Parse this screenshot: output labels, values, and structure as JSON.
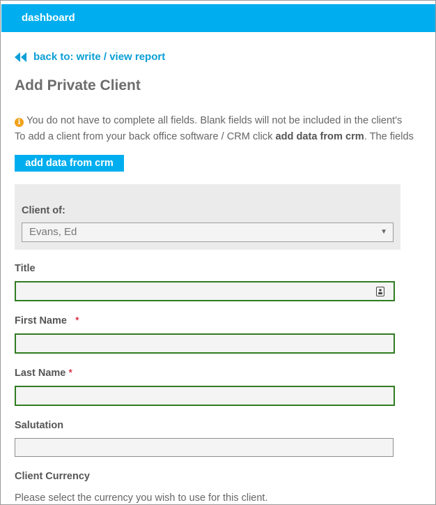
{
  "topbar": {
    "dashboard_label": "dashboard"
  },
  "back_link": {
    "label": "back to: write / view report"
  },
  "page_title": "Add Private Client",
  "info": {
    "line1": "You do not have to complete all fields. Blank fields will not be included in the client's",
    "line2_prefix": "To add a client from your back office software / CRM click ",
    "line2_bold": "add data from crm",
    "line2_suffix": ". The fields"
  },
  "crm_button": {
    "label": "add data from crm"
  },
  "client_of": {
    "label": "Client of:",
    "selected": "Evans, Ed"
  },
  "fields": {
    "title": {
      "label": "Title",
      "value": ""
    },
    "first_name": {
      "label": "First Name",
      "required_mark": "*",
      "value": ""
    },
    "last_name": {
      "label": "Last Name",
      "required_mark": "*",
      "value": ""
    },
    "salutation": {
      "label": "Salutation",
      "value": ""
    }
  },
  "currency": {
    "label": "Client Currency",
    "hint": "Please select the currency you wish to use for this client."
  },
  "colors": {
    "accent": "#00aeef",
    "valid_border": "#2f7d1f",
    "required": "#d0021b",
    "info_icon": "#f2a21b"
  },
  "icons": [
    "back-double-arrow-icon",
    "info-icon",
    "dropdown-caret-icon",
    "contact-card-icon"
  ]
}
